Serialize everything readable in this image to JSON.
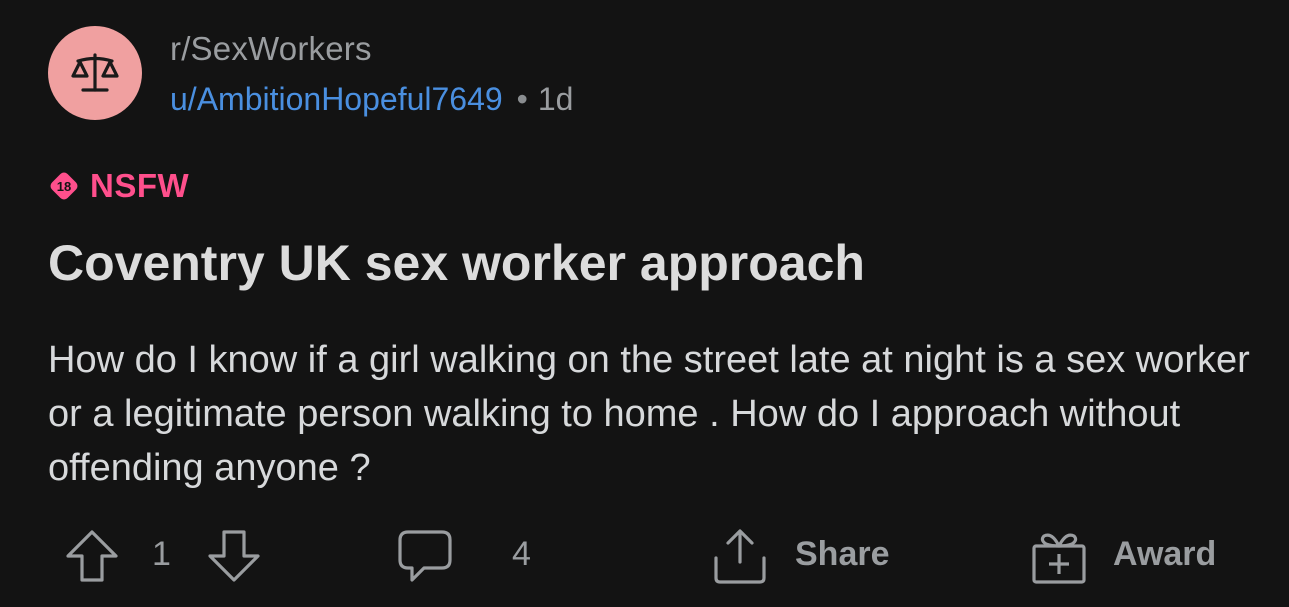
{
  "post": {
    "subreddit": "r/SexWorkers",
    "author": "u/AmbitionHopeful7649",
    "separator": "•",
    "age": "1d",
    "nsfw_badge": "18",
    "nsfw_label": "NSFW",
    "title": "Coventry UK sex worker approach",
    "body": "How do I know if a girl walking on the street late at night is a sex worker or a legitimate person walking to home . How do I approach without offending anyone ?"
  },
  "actions": {
    "vote_count": "1",
    "comment_count": "4",
    "share_label": "Share",
    "award_label": "Award"
  },
  "icons": {
    "avatar": "scales-icon",
    "nsfw": "nsfw-18-icon",
    "upvote": "arrow-up-icon",
    "downvote": "arrow-down-icon",
    "comment": "comment-bubble-icon",
    "share": "share-icon",
    "award": "gift-award-icon"
  },
  "colors": {
    "background": "#131313",
    "avatar_bg": "#f0a0a0",
    "username": "#4a8fe0",
    "nsfw": "#ff4f8c",
    "muted": "#9a9da0",
    "text": "#d7d9db"
  }
}
